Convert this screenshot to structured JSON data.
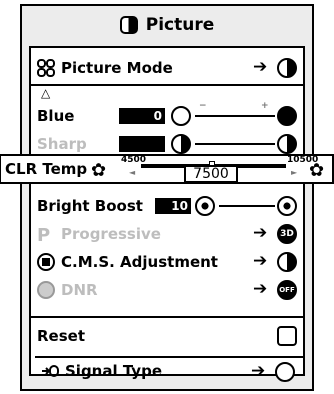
{
  "title": "Picture",
  "items": {
    "picture_mode": "Picture Mode",
    "blue": "Blue",
    "blue_value": "0",
    "sharp": "Sharp",
    "clr_temp": "CLR Temp",
    "clr_min": "4500",
    "clr_max": "10500",
    "clr_value": "7500",
    "bright_boost": "Bright Boost",
    "bright_boost_value": "10",
    "progressive": "Progressive",
    "progressive_badge": "3D",
    "cms": "C.M.S. Adjustment",
    "dnr": "DNR",
    "dnr_badge": "OFF",
    "reset": "Reset",
    "signal_type": "Signal Type"
  },
  "glyphs": {
    "arrow": "➔",
    "up": "△",
    "minus": "−",
    "plus": "+",
    "left": "◄",
    "right": "►"
  },
  "colors": {
    "frame_bg": "#ececec",
    "panel_bg": "#ffffff",
    "disabled_text": "#bdbdbd"
  }
}
